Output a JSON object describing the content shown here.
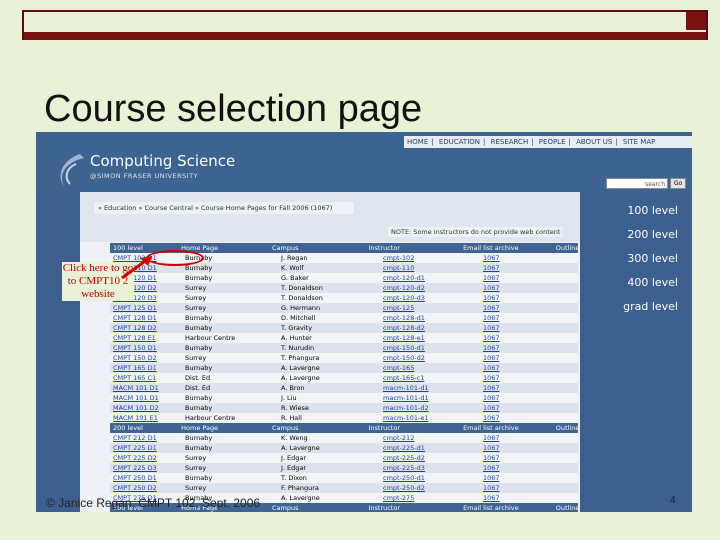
{
  "slide": {
    "title": "Course selection page",
    "annotation": "Click here to go to CMPT10 2 website",
    "footer": "© Janice Regan, CMPT 102, Sept. 2006",
    "page_number": "4"
  },
  "site": {
    "name": "Computing Science",
    "subtitle": "@SIMON FRASER UNIVERSITY",
    "nav": [
      "HOME",
      "EDUCATION",
      "RESEARCH",
      "PEOPLE",
      "ABOUT US",
      "SITE MAP"
    ],
    "search_button": "search",
    "go_button": "Go",
    "breadcrumb": "» Education » Course Central » Course Home Pages for Fall 2006 (1067)",
    "note": "NOTE: Some instructors do not provide web content",
    "levels": [
      "100 level",
      "200 level",
      "300 level",
      "400 level",
      "grad level"
    ]
  },
  "table": {
    "headers": [
      "100 level",
      "Home Page",
      "Campus",
      "Instructor",
      "Email list archive",
      "Outline"
    ],
    "rows": [
      [
        "CMPT 102 D1",
        "Burnaby",
        "J. Regan",
        "cmpt-102",
        "1067"
      ],
      [
        "CMPT 110 D1",
        "Burnaby",
        "K. Wolf",
        "cmpt-110",
        "1067"
      ],
      [
        "CMPT 120 D1",
        "Burnaby",
        "G. Baker",
        "cmpt-120-d1",
        "1067"
      ],
      [
        "CMPT 120 D2",
        "Surrey",
        "T. Donaldson",
        "cmpt-120-d2",
        "1067"
      ],
      [
        "CMPT 120 D3",
        "Surrey",
        "T. Donaldson",
        "cmpt-120-d3",
        "1067"
      ],
      [
        "CMPT 125 D1",
        "Surrey",
        "G. Hermann",
        "cmpt-125",
        "1067"
      ],
      [
        "CMPT 128 D1",
        "Burnaby",
        "D. Mitchell",
        "cmpt-128-d1",
        "1067"
      ],
      [
        "CMPT 128 D2",
        "Burnaby",
        "T. Gravity",
        "cmpt-128-d2",
        "1067"
      ],
      [
        "CMPT 128 E1",
        "Harbour Centre",
        "A. Hunter",
        "cmpt-128-e1",
        "1067"
      ],
      [
        "CMPT 150 D1",
        "Burnaby",
        "T. Nurudin",
        "cmpt-150-d1",
        "1067"
      ],
      [
        "CMPT 150 D2",
        "Surrey",
        "T. Phangura",
        "cmpt-150-d2",
        "1067"
      ],
      [
        "CMPT 165 D1",
        "Burnaby",
        "A. Lavergne",
        "cmpt-165",
        "1067"
      ],
      [
        "CMPT 165 C1",
        "Dist. Ed",
        "A. Lavergne",
        "cmpt-165-c1",
        "1067"
      ],
      [
        "MACM 101 D1",
        "Dist. Ed",
        "A. Bron",
        "macm-101-d1",
        "1067"
      ],
      [
        "MACM 101 D1",
        "Burnaby",
        "J. Liu",
        "macm-101-d1",
        "1067"
      ],
      [
        "MACM 101 D2",
        "Burnaby",
        "R. Wiese",
        "macm-101-d2",
        "1067"
      ],
      [
        "MACM 101 E1",
        "Harbour Centre",
        "R. Hall",
        "macm-101-e1",
        "1067"
      ]
    ],
    "headers2": [
      "200 level",
      "Home Page",
      "Campus",
      "Instructor",
      "Email list archive",
      "Outline"
    ],
    "rows2": [
      [
        "CMPT 212 D1",
        "Burnaby",
        "K. Weng",
        "cmpt-212",
        "1067"
      ],
      [
        "CMPT 225 D1",
        "Burnaby",
        "A. Lavergne",
        "cmpt-225-d1",
        "1067"
      ],
      [
        "CMPT 225 D2",
        "Surrey",
        "J. Edgar",
        "cmpt-225-d2",
        "1067"
      ],
      [
        "CMPT 225 D3",
        "Surrey",
        "J. Edgar",
        "cmpt-225-d3",
        "1067"
      ],
      [
        "CMPT 250 D1",
        "Burnaby",
        "T. Dixon",
        "cmpt-250-d1",
        "1067"
      ],
      [
        "CMPT 250 D2",
        "Surrey",
        "F. Phangura",
        "cmpt-250-d2",
        "1067"
      ],
      [
        "CMPT 275 D1",
        "Burnaby",
        "A. Lavergne",
        "cmpt-275",
        "1067"
      ]
    ],
    "footer_row": [
      "300 level",
      "Home Page",
      "Campus",
      "Instructor",
      "Email list archive",
      "Outline"
    ]
  }
}
